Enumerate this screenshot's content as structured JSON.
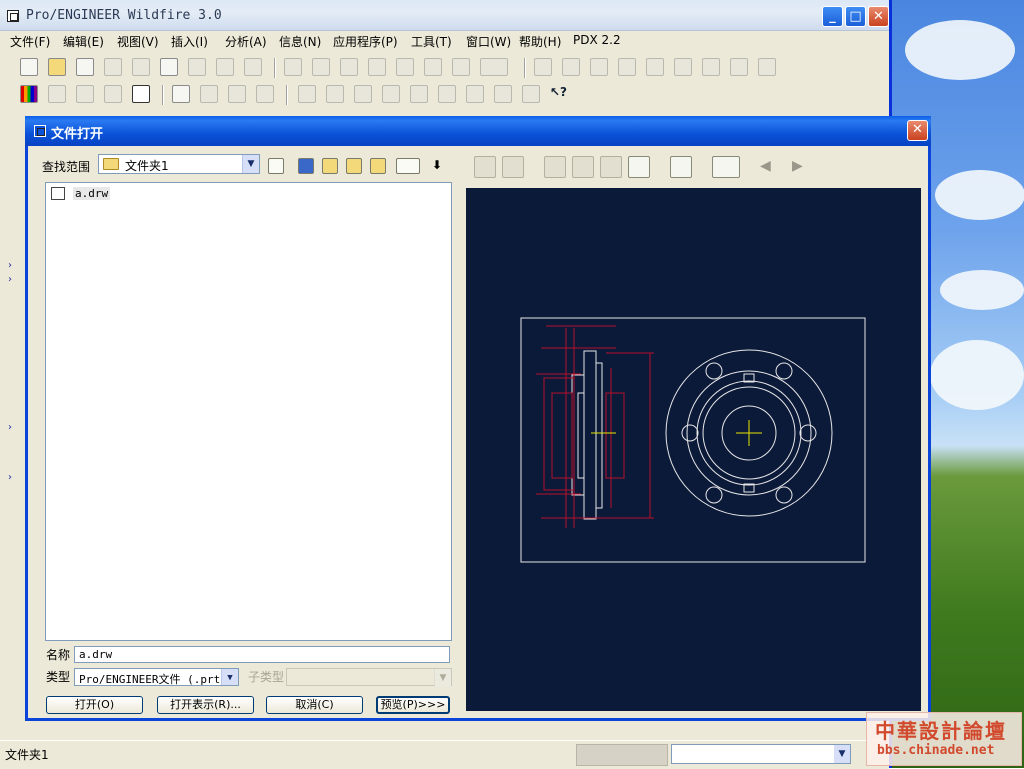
{
  "app": {
    "title": "Pro/ENGINEER Wildfire 3.0",
    "menu": [
      "文件(F)",
      "编辑(E)",
      "视图(V)",
      "插入(I)",
      "分析(A)",
      "信息(N)",
      "应用程序(P)",
      "工具(T)",
      "窗口(W)",
      "帮助(H)",
      "PDX 2.2"
    ]
  },
  "dialog": {
    "title": "文件打开",
    "look_in_label": "查找范围",
    "look_in_value": "文件夹1",
    "files": [
      "a.drw"
    ],
    "name_label": "名称",
    "name_value": "a.drw",
    "type_label": "类型",
    "type_value": "Pro/ENGINEER文件 (.prt,",
    "subtype_label": "子类型",
    "buttons": {
      "open": "打开(O)",
      "open_rep": "打开表示(R)...",
      "cancel": "取消(C)",
      "preview": "预览(P)>>>"
    }
  },
  "status": {
    "text": "文件夹1"
  },
  "watermark": {
    "title": "中華設計論壇",
    "url": "bbs.chinade.net"
  },
  "colors": {
    "preview_bg": "#0c1a3a",
    "drawing_line": "#e6e6e6",
    "dimension": "#b8102a",
    "center_mark": "#e6e600",
    "xp_title_blue": "#0a52d8"
  }
}
